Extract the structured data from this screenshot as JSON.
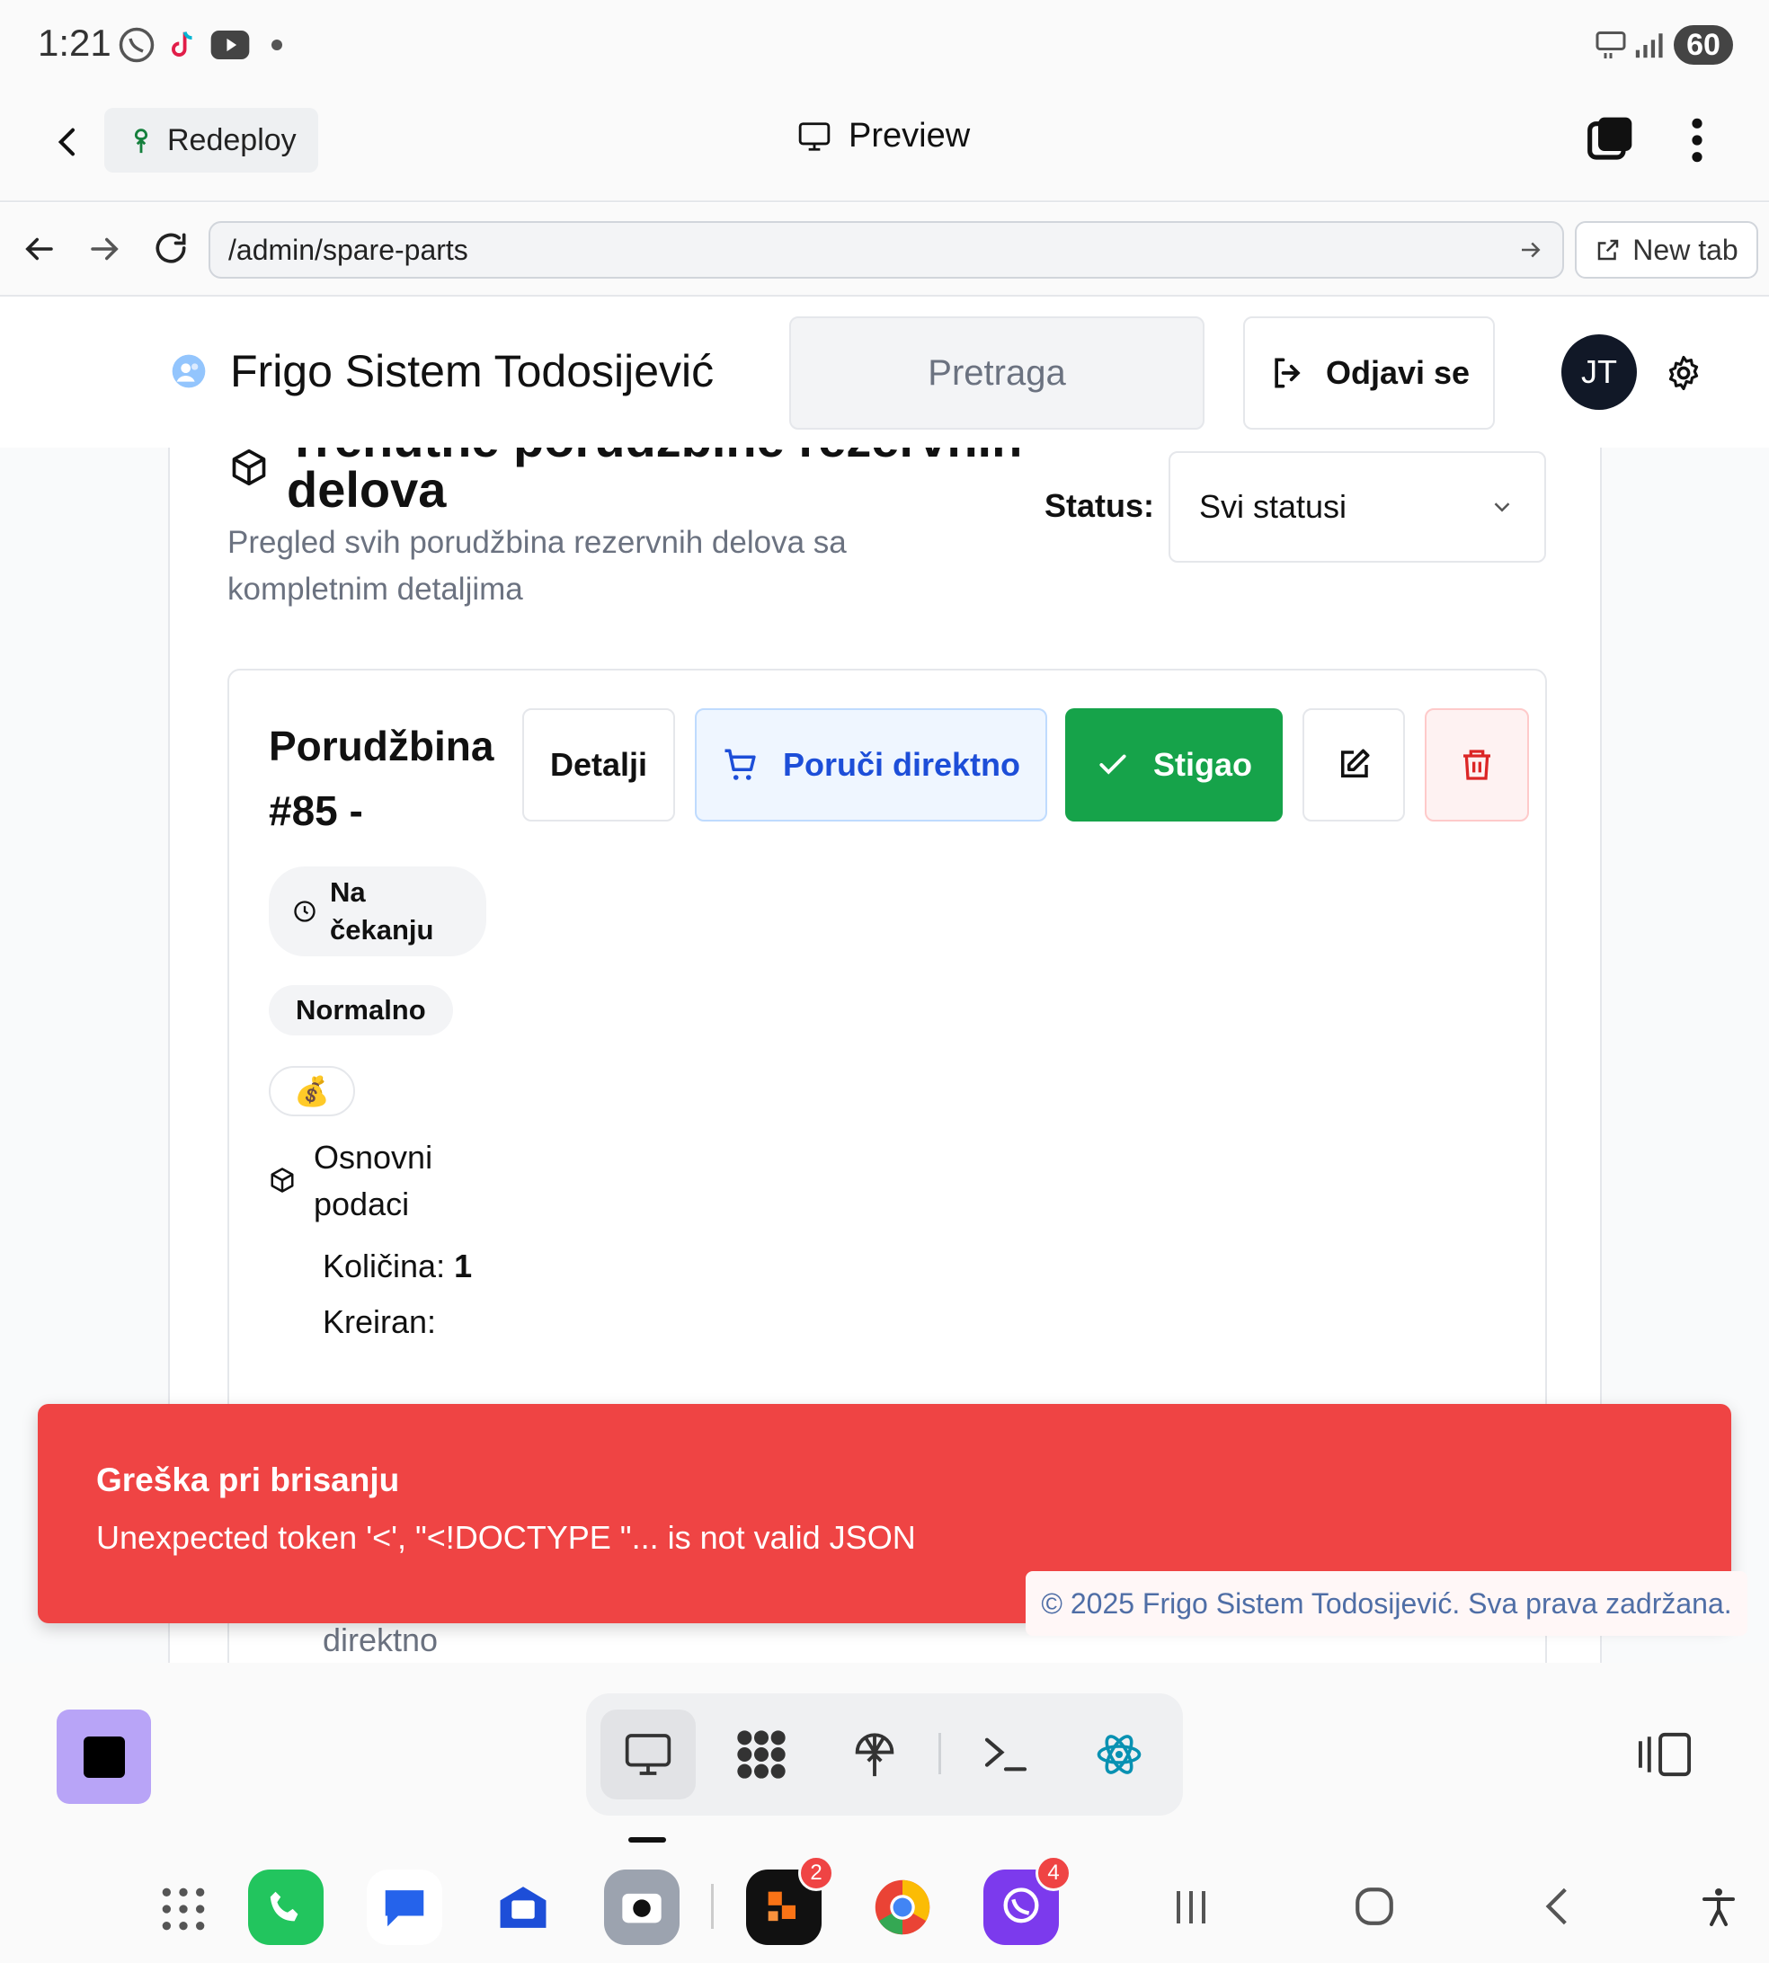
{
  "status_bar": {
    "time": "1:21",
    "battery": "60"
  },
  "appbar": {
    "redeploy_label": "Redeploy",
    "preview_label": "Preview"
  },
  "browser": {
    "url": "/admin/spare-parts",
    "new_tab_label": "New tab"
  },
  "header": {
    "brand": "Frigo Sistem Todosijević",
    "search_placeholder": "Pretraga",
    "logout_label": "Odjavi se",
    "avatar_initials": "JT"
  },
  "page": {
    "title_cut": "Trenutne porudžbine rezervnih",
    "title_main": "delova",
    "subtitle": "Pregled svih porudžbina rezervnih delova sa kompletnim detaljima",
    "status_label": "Status:",
    "status_value": "Svi statusi"
  },
  "order": {
    "title": "Porudžbina #85 -",
    "buttons": {
      "details": "Detalji",
      "order_direct": "Poruči direktno",
      "arrived": "Stigao"
    },
    "status_badge": "Na čekanju",
    "priority_badge": "Normalno",
    "money_emoji": "💰",
    "basic_section": "Osnovni podaci",
    "quantity_label": "Količina:",
    "quantity_value": "1",
    "created_label": "Kreiran:",
    "partial_text": "direktno"
  },
  "toast": {
    "title": "Greška pri brisanju",
    "message": "Unexpected token '<', \"<!DOCTYPE \"... is not valid JSON"
  },
  "footer": {
    "copyright": "© 2025 Frigo Sistem Todosijević. Sva prava zadržana."
  },
  "dock": {
    "badges": {
      "app_orange": "2",
      "viber": "4"
    }
  },
  "colors": {
    "success": "#16a34a",
    "danger": "#ef4444",
    "primary": "#1d4ed8",
    "dark": "#111827"
  }
}
